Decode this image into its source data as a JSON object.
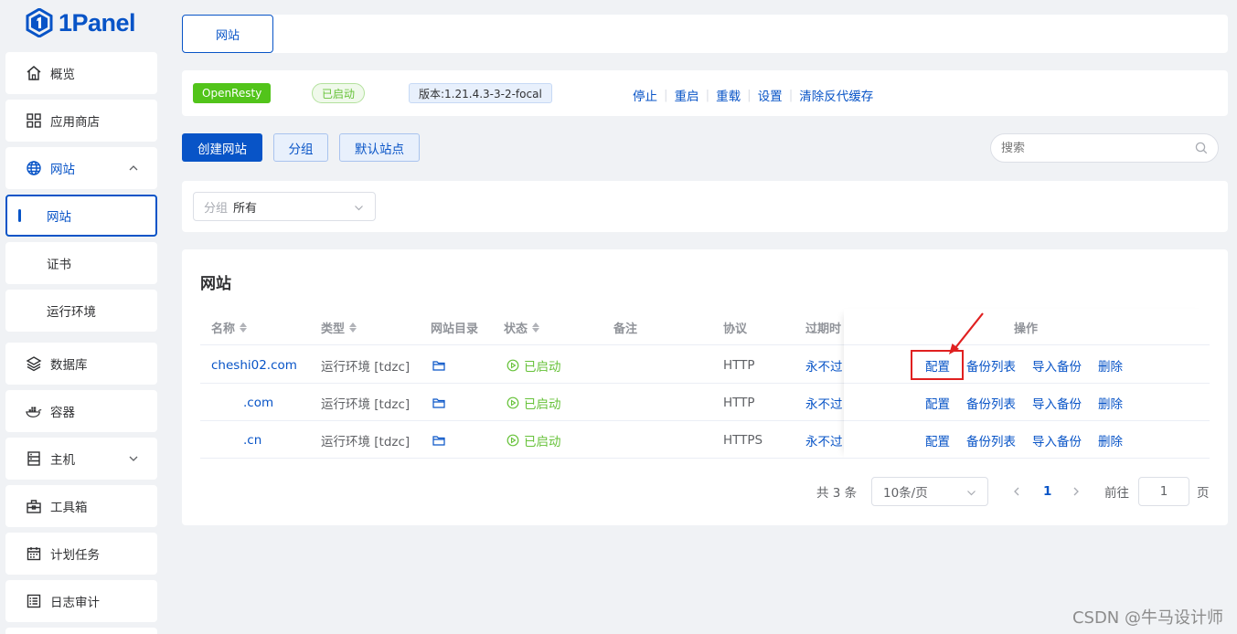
{
  "brand": {
    "name": "1Panel",
    "color": "#0854c7"
  },
  "sidebar": {
    "items": [
      {
        "label": "概览",
        "icon": "home-icon"
      },
      {
        "label": "应用商店",
        "icon": "apps-grid-icon"
      },
      {
        "label": "网站",
        "icon": "globe-icon",
        "expanded": true
      },
      {
        "label": "网站",
        "sub": true,
        "active": true
      },
      {
        "label": "证书",
        "sub": true
      },
      {
        "label": "运行环境",
        "sub": true
      },
      {
        "label": "数据库",
        "icon": "layers-icon"
      },
      {
        "label": "容器",
        "icon": "docker-icon"
      },
      {
        "label": "主机",
        "icon": "server-icon",
        "expandable": true
      },
      {
        "label": "工具箱",
        "icon": "toolbox-icon"
      },
      {
        "label": "计划任务",
        "icon": "calendar-icon"
      },
      {
        "label": "日志审计",
        "icon": "log-icon"
      }
    ]
  },
  "header": {
    "tab": "网站"
  },
  "server_bar": {
    "name": "OpenResty",
    "status": "已启动",
    "version": "版本:1.21.4.3-3-2-focal",
    "actions": [
      "停止",
      "重启",
      "重载",
      "设置",
      "清除反代缓存"
    ]
  },
  "toolbar": {
    "create": "创建网站",
    "group": "分组",
    "default_site": "默认站点",
    "search_placeholder": "搜索"
  },
  "filter": {
    "prefix": "分组",
    "value": "所有"
  },
  "section_title": "网站",
  "table": {
    "columns": [
      "名称",
      "类型",
      "网站目录",
      "状态",
      "备注",
      "协议",
      "过期时",
      "操作"
    ],
    "rows": [
      {
        "name": "cheshi02.com",
        "type": "运行环境 [tdzc]",
        "status": "已启动",
        "remark": "",
        "protocol": "HTTP",
        "expire": "永不过"
      },
      {
        "name": ".com",
        "type": "运行环境 [tdzc]",
        "status": "已启动",
        "remark": "",
        "protocol": "HTTP",
        "expire": "永不过"
      },
      {
        "name": ".cn",
        "type": "运行环境 [tdzc]",
        "status": "已启动",
        "remark": "",
        "protocol": "HTTPS",
        "expire": "永不过"
      }
    ],
    "row_actions": [
      "配置",
      "备份列表",
      "导入备份",
      "删除"
    ]
  },
  "pagination": {
    "total": "共 3 条",
    "page_size": "10条/页",
    "current": "1",
    "goto_prefix": "前往",
    "goto_value": "1",
    "goto_suffix": "页"
  },
  "watermark": "CSDN @牛马设计师",
  "colors": {
    "primary": "#0854c7",
    "success": "#67c23a",
    "highlight": "#e02020"
  }
}
